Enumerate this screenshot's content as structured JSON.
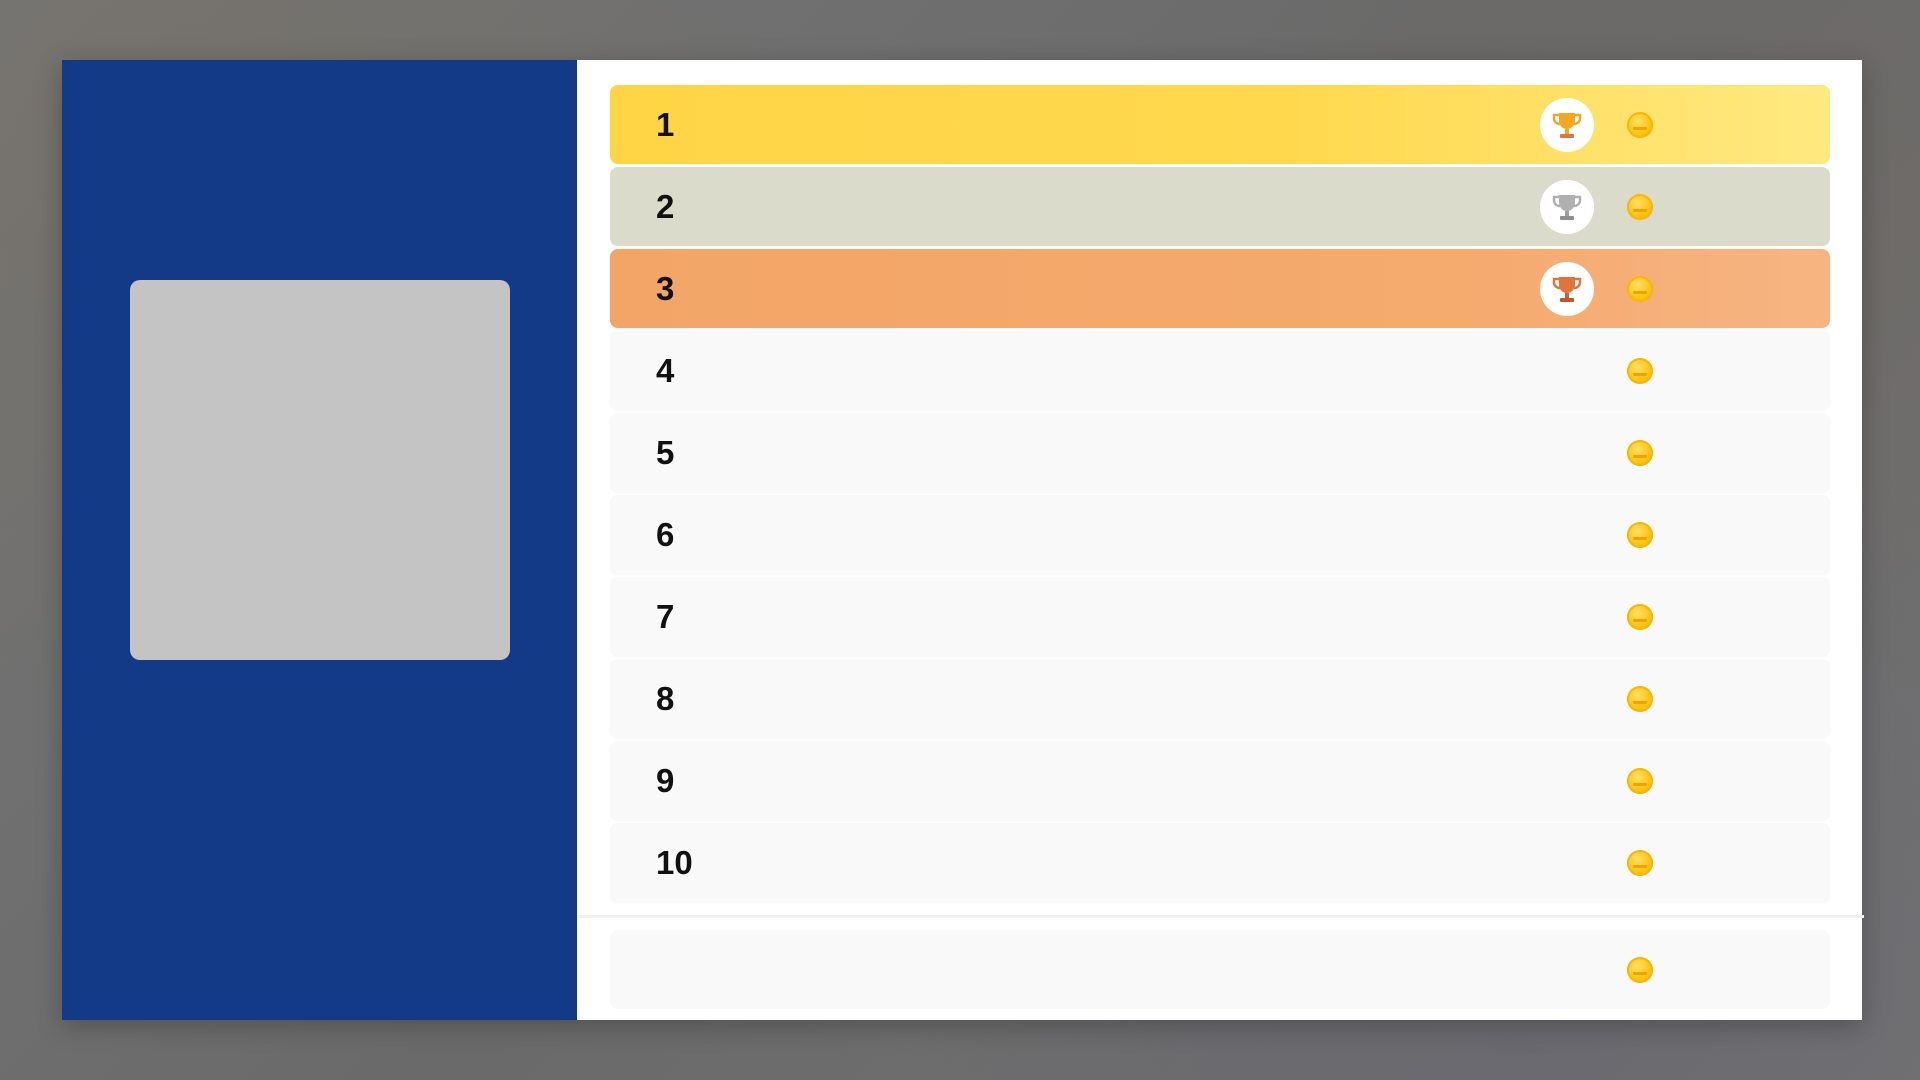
{
  "leaderboard": {
    "rows": [
      {
        "rank": "1",
        "tier": "gold",
        "trophy": "gold-trophy-icon",
        "trophy_color": "#f5a623",
        "coin": "coin-icon"
      },
      {
        "rank": "2",
        "tier": "silver",
        "trophy": "silver-trophy-icon",
        "trophy_color": "#a8a8a8",
        "coin": "coin-icon"
      },
      {
        "rank": "3",
        "tier": "bronze",
        "trophy": "bronze-trophy-icon",
        "trophy_color": "#e2733a",
        "coin": "coin-icon"
      },
      {
        "rank": "4",
        "tier": "plain",
        "coin": "coin-icon"
      },
      {
        "rank": "5",
        "tier": "plain",
        "coin": "coin-icon"
      },
      {
        "rank": "6",
        "tier": "plain",
        "coin": "coin-icon"
      },
      {
        "rank": "7",
        "tier": "plain",
        "coin": "coin-icon"
      },
      {
        "rank": "8",
        "tier": "plain",
        "coin": "coin-icon"
      },
      {
        "rank": "9",
        "tier": "plain",
        "coin": "coin-icon"
      },
      {
        "rank": "10",
        "tier": "plain",
        "coin": "coin-icon"
      }
    ],
    "self_row": {
      "rank": "",
      "coin": "coin-icon"
    }
  },
  "colors": {
    "left_pane": "#123a86",
    "gold_row": "#ffd546",
    "silver_row": "#dadbca",
    "bronze_row": "#f2a566",
    "coin": "#ffc414"
  }
}
